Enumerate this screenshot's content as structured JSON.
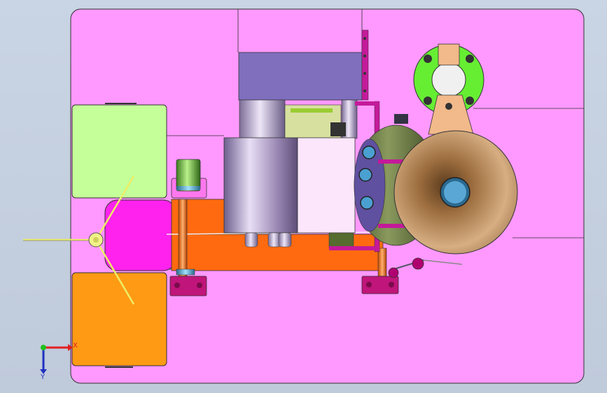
{
  "viewport": {
    "background_top": "#c9d4e4",
    "background_bottom": "#bfcadb",
    "plate_color": "#ff99ff",
    "outline_color": "#333333"
  },
  "triad": {
    "x_label": "X",
    "y_label": "Y",
    "x_color": "#e02020",
    "y_color": "#2030c0",
    "origin_color": "#20c020"
  },
  "parts": {
    "pad_top_color": "#c4ff99",
    "pad_middle_color": "#ff22ee",
    "pad_bottom_color": "#ff9a14",
    "frame_color": "#ff6a10",
    "motor_color": "#7f6fbd",
    "flange_color": "#66ee33",
    "disk_color": "#c89a6c",
    "cylinder_color": "#a090b0",
    "handle_color": "#b00070"
  }
}
